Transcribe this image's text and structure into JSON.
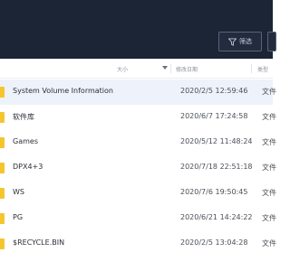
{
  "toolbar": {
    "filter_label": "筛选"
  },
  "columns": {
    "size": "大小",
    "modified": "修改日期",
    "type": "类型"
  },
  "rows": [
    {
      "name": "System Volume Information",
      "modified": "2020/2/5 12:59:46",
      "type": "文件"
    },
    {
      "name": "软件库",
      "modified": "2020/6/7 17:24:58",
      "type": "文件"
    },
    {
      "name": "Games",
      "modified": "2020/5/12 11:48:24",
      "type": "文件"
    },
    {
      "name": "DPX4+3",
      "modified": "2020/7/18 22:51:18",
      "type": "文件"
    },
    {
      "name": "WS",
      "modified": "2020/7/6 19:50:45",
      "type": "文件"
    },
    {
      "name": "PG",
      "modified": "2020/6/21 14:24:22",
      "type": "文件"
    },
    {
      "name": "$RECYCLE.BIN",
      "modified": "2020/2/5 13:04:28",
      "type": "文件"
    }
  ]
}
